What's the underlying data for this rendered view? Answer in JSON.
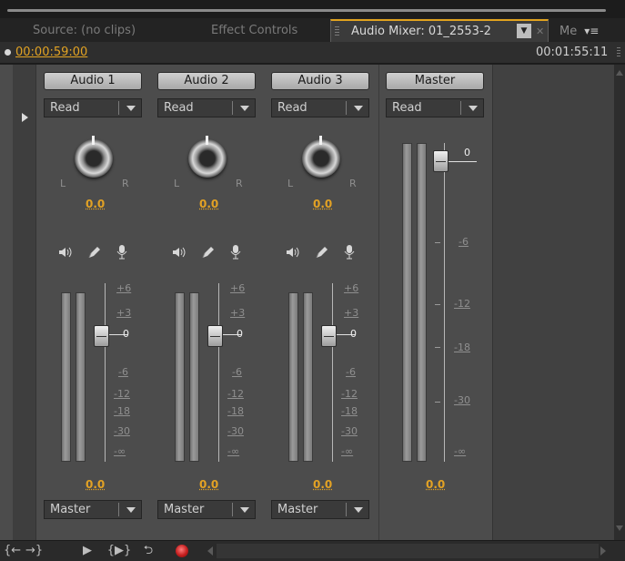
{
  "tabs": {
    "source": "Source: (no clips)",
    "effect_controls": "Effect Controls",
    "audio_mixer": "Audio Mixer: 01_2553-2",
    "more": "Me"
  },
  "timecode": {
    "current": "00:00:59:00",
    "duration": "00:01:55:11"
  },
  "channels": [
    {
      "name": "Audio 1",
      "automation": "Read",
      "pan_value": "0.0",
      "volume_value": "0.0",
      "output": "Master"
    },
    {
      "name": "Audio 2",
      "automation": "Read",
      "pan_value": "0.0",
      "volume_value": "0.0",
      "output": "Master"
    },
    {
      "name": "Audio 3",
      "automation": "Read",
      "pan_value": "0.0",
      "volume_value": "0.0",
      "output": "Master"
    }
  ],
  "master": {
    "name": "Master",
    "automation": "Read",
    "volume_value": "0.0"
  },
  "pan_labels": {
    "left": "L",
    "right": "R"
  },
  "track_scale": [
    "+6",
    "+3",
    "0",
    "-6",
    "-12",
    "-18",
    "-30",
    "-∞"
  ],
  "master_scale": [
    "0",
    "-6",
    "-12",
    "-18",
    "-30",
    "-∞"
  ],
  "icons": {
    "mute": "speaker-icon",
    "solo": "pencil-icon",
    "record": "microphone-icon",
    "transport": [
      "go-to-in-point-icon",
      "go-to-out-point-icon",
      "play-icon",
      "play-in-to-out-icon",
      "loop-icon",
      "record-icon"
    ]
  },
  "colors": {
    "accent": "#e3a224",
    "record": "#c41e1e",
    "background": "#4c4c4c"
  }
}
